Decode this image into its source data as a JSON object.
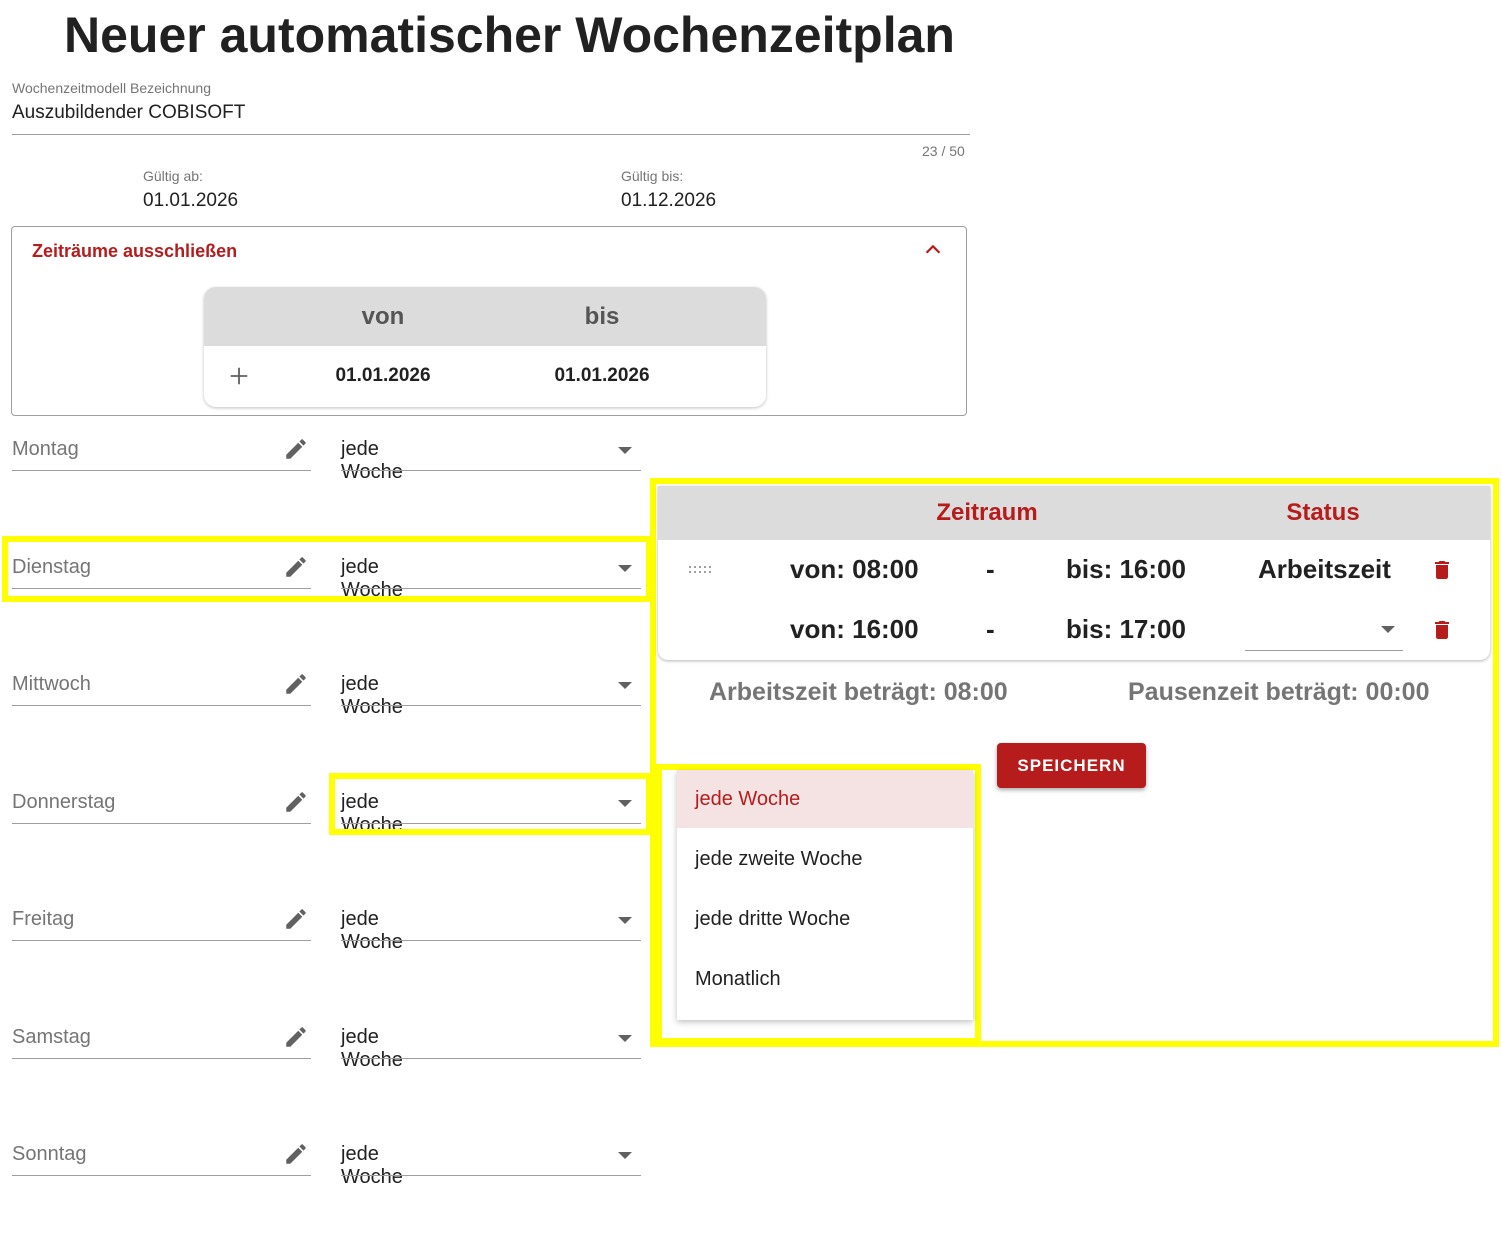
{
  "page": {
    "title": "Neuer automatischer Wochenzeitplan"
  },
  "name_field": {
    "label": "Wochenzeitmodell Bezeichnung",
    "value": "Auszubildender COBISOFT",
    "counter": "23 / 50"
  },
  "valid_from": {
    "label": "Gültig ab:",
    "value": "01.01.2026"
  },
  "valid_to": {
    "label": "Gültig bis:",
    "value": "01.12.2026"
  },
  "exclude": {
    "title": "Zeiträume ausschließen",
    "col_from": "von",
    "col_to": "bis",
    "row": {
      "from": "01.01.2026",
      "to": "01.01.2026"
    }
  },
  "days": [
    {
      "label": "Montag",
      "frequency": "jede Woche"
    },
    {
      "label": "Dienstag",
      "frequency": "jede Woche"
    },
    {
      "label": "Mittwoch",
      "frequency": "jede Woche"
    },
    {
      "label": "Donnerstag",
      "frequency": "jede Woche"
    },
    {
      "label": "Freitag",
      "frequency": "jede Woche"
    },
    {
      "label": "Samstag",
      "frequency": "jede Woche"
    },
    {
      "label": "Sonntag",
      "frequency": "jede Woche"
    }
  ],
  "detail": {
    "col_period": "Zeitraum",
    "col_status": "Status",
    "rows": [
      {
        "from": "von: 08:00",
        "dash": "-",
        "to": "bis: 16:00",
        "status": "Arbeitszeit"
      },
      {
        "from": "von: 16:00",
        "dash": "-",
        "to": "bis: 17:00",
        "status": ""
      }
    ],
    "work_total": "Arbeitszeit beträgt: 08:00",
    "break_total": "Pausenzeit beträgt: 00:00",
    "save_label": "SPEICHERN"
  },
  "frequency_options": [
    "jede Woche",
    "jede zweite Woche",
    "jede dritte Woche",
    "Monatlich"
  ],
  "colors": {
    "accent": "#b71c1c",
    "highlight": "#ffff00",
    "header_bg": "#dcdcdc"
  }
}
